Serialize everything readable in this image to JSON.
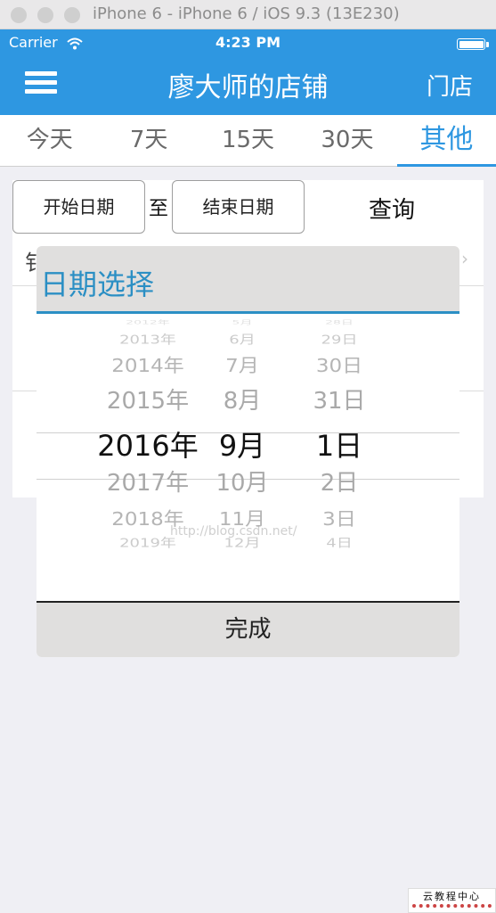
{
  "simulator": {
    "title": "iPhone 6 - iPhone 6 / iOS 9.3 (13E230)"
  },
  "status_bar": {
    "carrier": "Carrier",
    "time": "4:23 PM"
  },
  "nav": {
    "title": "廖大师的店铺",
    "right_button": "门店"
  },
  "tabs": [
    {
      "label": "今天",
      "active": false
    },
    {
      "label": "7天",
      "active": false
    },
    {
      "label": "15天",
      "active": false
    },
    {
      "label": "30天",
      "active": false
    },
    {
      "label": "其他",
      "active": true
    }
  ],
  "filter": {
    "start_date_label": "开始日期",
    "to_label": "至",
    "end_date_label": "结束日期",
    "query_label": "查询"
  },
  "background_row": {
    "peek_text": "钅",
    "chevron": "›"
  },
  "date_picker": {
    "title": "日期选择",
    "years": [
      "2012年",
      "2013年",
      "2014年",
      "2015年",
      "2016年",
      "2017年",
      "2018年",
      "2019年"
    ],
    "months": [
      "5月",
      "6月",
      "7月",
      "8月",
      "9月",
      "10月",
      "11月",
      "12月"
    ],
    "days": [
      "28日",
      "29日",
      "30日",
      "31日",
      "1日",
      "2日",
      "3日",
      "4日"
    ],
    "selected": {
      "year": "2016年",
      "month": "9月",
      "day": "1日"
    },
    "done_label": "完成"
  },
  "watermark": "http://blog.csdn.net/",
  "corner_logo": {
    "text": "云教程中心"
  },
  "colors": {
    "accent": "#2e97e1",
    "modal_accent": "#2b8fc4"
  }
}
